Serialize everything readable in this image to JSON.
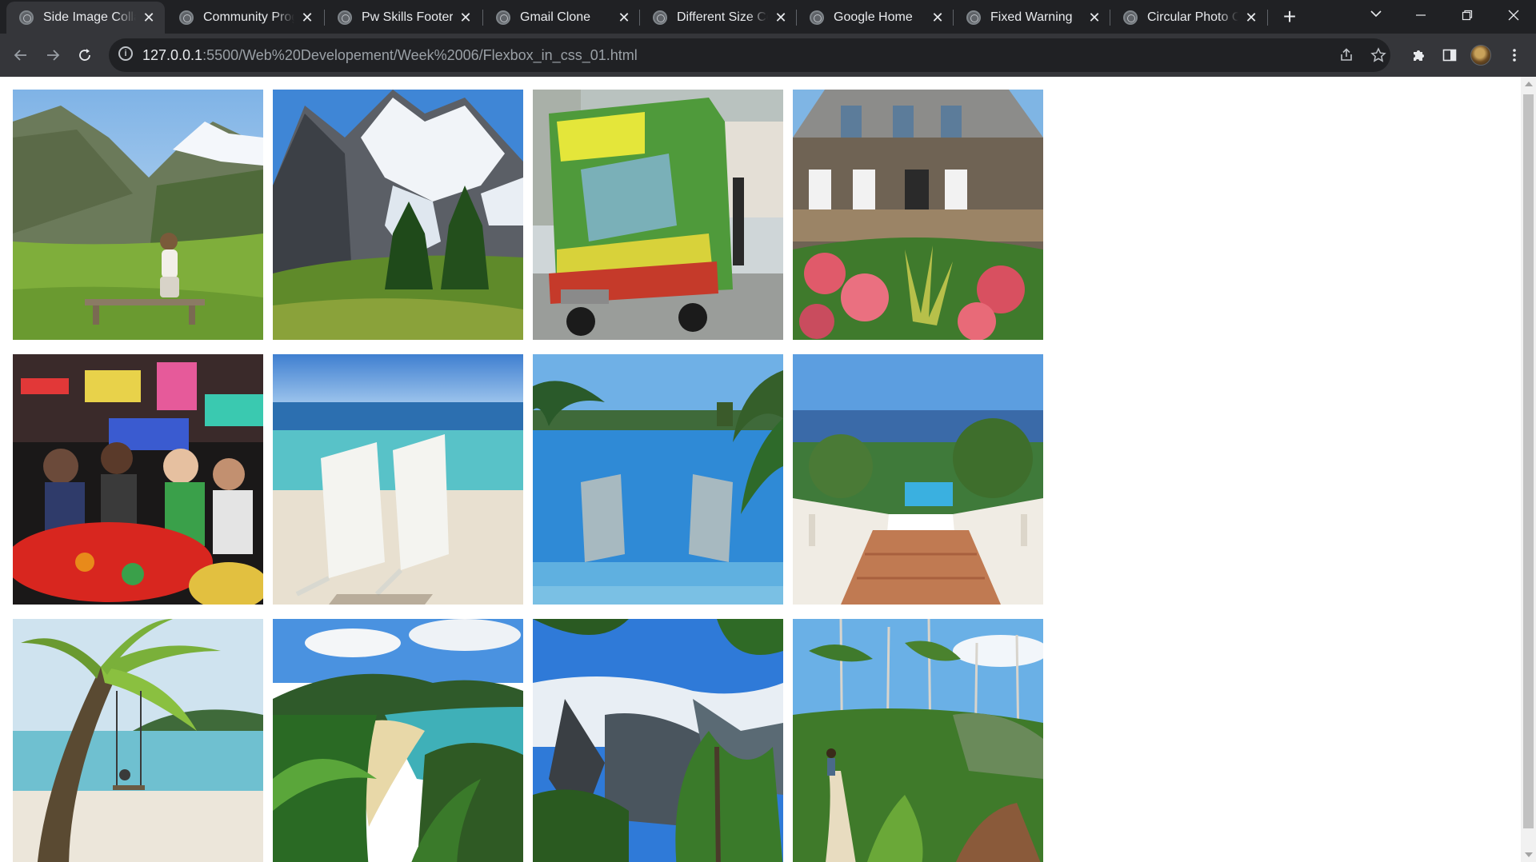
{
  "browser": {
    "tabs": [
      {
        "title": "Side Image Colla",
        "active": true
      },
      {
        "title": "Community Prog",
        "active": false
      },
      {
        "title": "Pw Skills Footer",
        "active": false
      },
      {
        "title": "Gmail Clone",
        "active": false
      },
      {
        "title": "Different Size Co",
        "active": false
      },
      {
        "title": "Google Home",
        "active": false
      },
      {
        "title": "Fixed Warning",
        "active": false
      },
      {
        "title": "Circular Photo C",
        "active": false
      }
    ],
    "address": {
      "host": "127.0.0.1",
      "path": ":5500/Web%20Developement/Week%2006/Flexbox_in_css_01.html"
    }
  },
  "gallery": {
    "photos": [
      {
        "scene": "mountain-valley-woman-bench"
      },
      {
        "scene": "glacier-mountains-forest"
      },
      {
        "scene": "food-truck-street"
      },
      {
        "scene": "stone-house-flowers"
      },
      {
        "scene": "night-market-dinner"
      },
      {
        "scene": "beach-chairs"
      },
      {
        "scene": "infinity-pool-palms"
      },
      {
        "scene": "resort-staircase-sea"
      },
      {
        "scene": "palm-beach-swing"
      },
      {
        "scene": "bay-beach-ferns"
      },
      {
        "scene": "glacier-forest-valley"
      },
      {
        "scene": "forest-trail-hiker"
      }
    ]
  },
  "colors": {
    "tabstrip": "#202124",
    "toolbar": "#35363a",
    "page": "#ffffff"
  }
}
